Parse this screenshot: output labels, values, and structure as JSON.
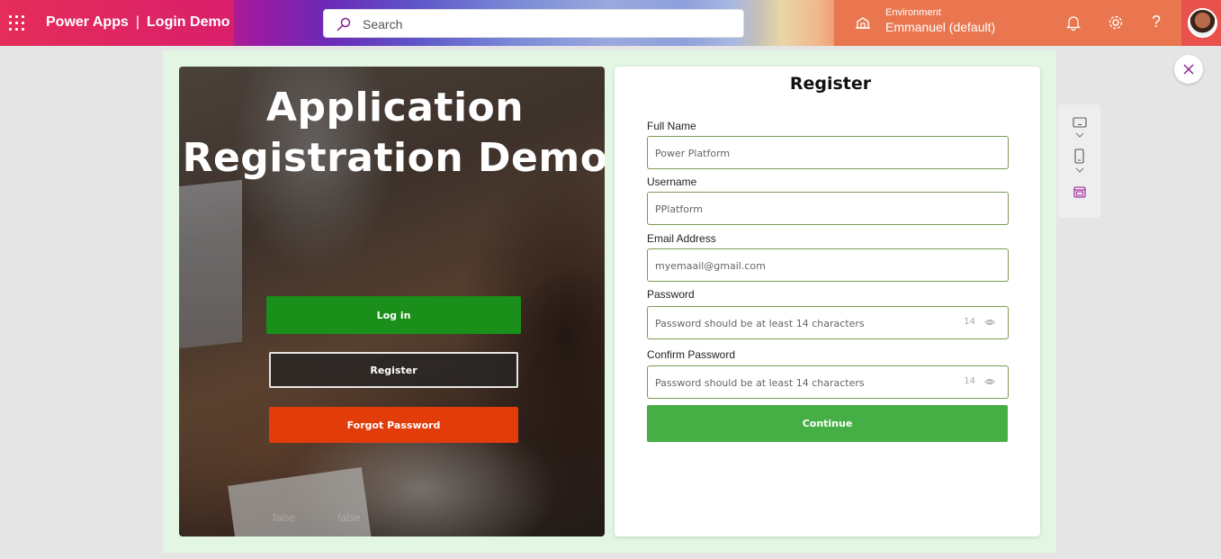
{
  "header": {
    "app_name": "Power Apps",
    "separator": "|",
    "app_title": "Login Demo",
    "search_placeholder": "Search",
    "environment_label": "Environment",
    "environment_name": "Emmanuel (default)",
    "help_label": "?"
  },
  "hero": {
    "title_line1": "Application",
    "title_line2": "Registration Demo",
    "login_label": "Log in",
    "register_label": "Register",
    "forgot_label": "Forgot Password",
    "hidden_text_1": "false",
    "hidden_text_2": "false"
  },
  "register_form": {
    "title": "Register",
    "full_name": {
      "label": "Full Name",
      "placeholder": "Power Platform"
    },
    "username": {
      "label": "Username",
      "placeholder": "PPlatform"
    },
    "email": {
      "label": "Email Address",
      "placeholder": "myemaail@gmail.com"
    },
    "password": {
      "label": "Password",
      "placeholder": "Password should be at least 14 characters",
      "counter": "14"
    },
    "confirm_password": {
      "label": "Confirm Password",
      "placeholder": "Password should be at least 14 characters",
      "counter": "14"
    },
    "continue_label": "Continue"
  },
  "colors": {
    "login_green": "#1a8f1a",
    "forgot_orange": "#e33c0b",
    "continue_green": "#45af45",
    "field_border": "#7b9a55"
  },
  "icons": [
    "waffle-icon",
    "search-icon",
    "environment-icon",
    "bell-icon",
    "gear-icon",
    "help-icon",
    "close-icon",
    "tablet-icon",
    "phone-icon",
    "calendar-icon",
    "eye-icon"
  ]
}
